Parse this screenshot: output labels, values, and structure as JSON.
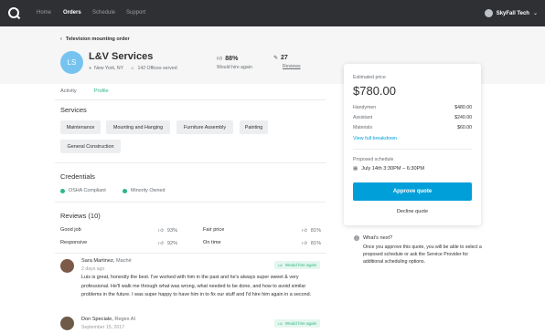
{
  "nav": {
    "links": [
      "Home",
      "Orders",
      "Schedule",
      "Support"
    ],
    "active": "Orders",
    "user_name": "SkyFall Tech"
  },
  "header": {
    "back_label": "Television mounting order",
    "provider_initials": "LS",
    "provider_name": "L&V Services",
    "location": "New York, NY",
    "offices": "142 Offices served",
    "hire_rate": "88%",
    "hire_label": "Would hire again",
    "review_count": "27",
    "review_label": "Reviews"
  },
  "tabs": [
    "Activity",
    "Profile"
  ],
  "services": {
    "title": "Services",
    "items": [
      "Maintenance",
      "Mounting and Hanging",
      "Furniture Assembly",
      "Painting",
      "General Construction"
    ]
  },
  "credentials": {
    "title": "Credentials",
    "items": [
      "OSHA Compliant",
      "Minority Owned"
    ]
  },
  "reviews": {
    "title": "Reviews (10)",
    "ratings": [
      {
        "label": "Good job",
        "pct": "93%"
      },
      {
        "label": "Fair price",
        "pct": "81%"
      },
      {
        "label": "Responsive",
        "pct": "92%"
      },
      {
        "label": "On time",
        "pct": "81%"
      }
    ],
    "list": [
      {
        "name": "Sara Martinez,",
        "category": "Maché",
        "date": "2 days ago",
        "badge": "Would hire again",
        "text": "Luis is great, honestly the best. I've worked with him in the past and he's always super sweet & very professional. He'll walk me through what was wrong, what needed to be done, and how to avoid similar problems in the future. I was super happy to have him in to fix our stuff and I'd hire him again in a second."
      },
      {
        "name": "Don Speciale,",
        "category": "Regex AI",
        "date": "September 15, 2017",
        "badge": "Would hire again",
        "text": ""
      }
    ]
  },
  "quote": {
    "estimated_label": "Estimated price",
    "price": "$780.00",
    "lines": [
      {
        "name": "Handymen",
        "amount": "$480.00"
      },
      {
        "name": "Assistant",
        "amount": "$240.00"
      },
      {
        "name": "Materials",
        "amount": "$60.00"
      }
    ],
    "breakdown_link": "View full breakdown",
    "schedule_label": "Proposed schedule",
    "schedule_value": "July 14th 3:30PM – 6:30PM",
    "approve_label": "Approve quote",
    "decline_label": "Decline quote"
  },
  "whats_next": {
    "title": "What's next?",
    "body": "Once you approve this quote, you will be able to select a proposed schedule or ask the Service Provider for additional scheduling options."
  },
  "colors": {
    "nav_bg": "#2f3033",
    "accent_blue": "#009fd9",
    "accent_green": "#2db783",
    "avatar_blue": "#76c3f0"
  }
}
